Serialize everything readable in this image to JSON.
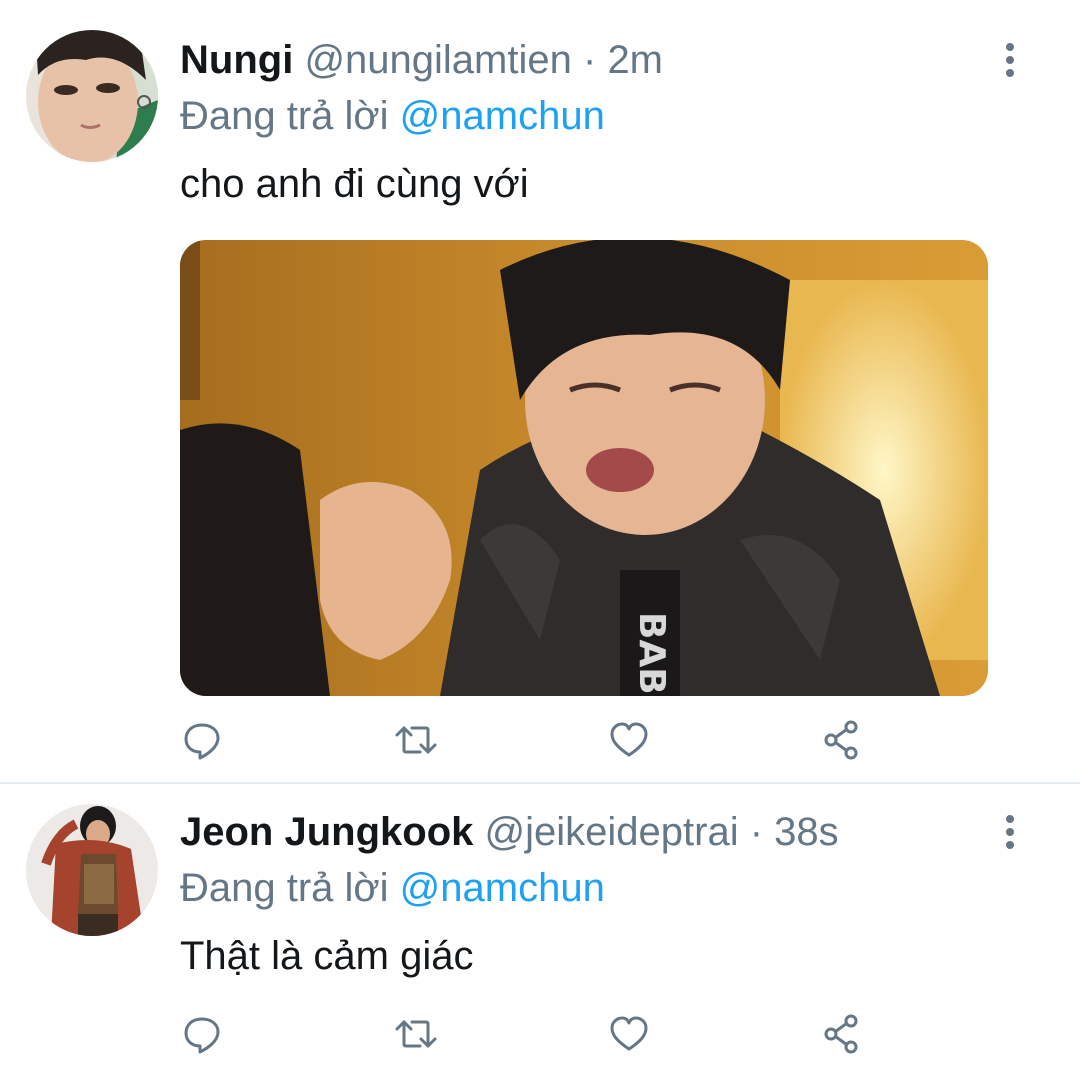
{
  "colors": {
    "accent": "#1da1f2",
    "secondary_text": "#657786",
    "primary_text": "#14171a",
    "divider": "#e6ecf0"
  },
  "tweets": [
    {
      "display_name": "Nungi",
      "handle": "@nungilamtien",
      "separator": "·",
      "time": "2m",
      "reply_prefix": "Đang trả lời",
      "reply_to": "@namchun",
      "text": "cho anh đi cùng với",
      "has_media": true,
      "icons": [
        "more-vertical-icon",
        "reply-icon",
        "retweet-icon",
        "like-icon",
        "share-icon"
      ]
    },
    {
      "display_name": "Jeon Jungkook",
      "handle": "@jeikeideptrai",
      "separator": "·",
      "time": "38s",
      "reply_prefix": "Đang trả lời",
      "reply_to": "@namchun",
      "text": "Thật là cảm giác",
      "has_media": false,
      "icons": [
        "more-vertical-icon",
        "reply-icon",
        "retweet-icon",
        "like-icon",
        "share-icon"
      ]
    }
  ]
}
